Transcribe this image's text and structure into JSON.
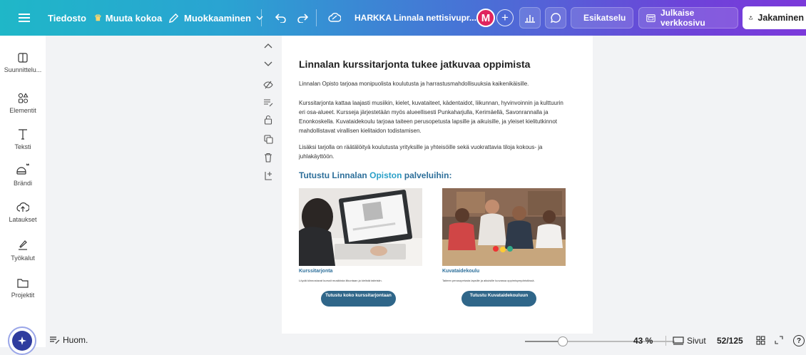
{
  "toolbar": {
    "file_label": "Tiedosto",
    "resize_label": "Muuta kokoa",
    "edit_label": "Muokkaaminen",
    "doc_title": "HARKKA Linnala nettisivupr...",
    "avatar_initial": "M",
    "preview_label": "Esikatselu",
    "publish_label": "Julkaise verkkosivu",
    "share_label": "Jakaminen"
  },
  "sidebar": {
    "items": [
      {
        "label": "Suunnittelu...",
        "icon": "design-icon"
      },
      {
        "label": "Elementit",
        "icon": "elements-icon"
      },
      {
        "label": "Teksti",
        "icon": "text-icon"
      },
      {
        "label": "Brändi",
        "icon": "brand-icon"
      },
      {
        "label": "Lataukset",
        "icon": "uploads-icon"
      },
      {
        "label": "Työkalut",
        "icon": "tools-icon"
      },
      {
        "label": "Projektit",
        "icon": "projects-icon"
      }
    ]
  },
  "page": {
    "heading": "Linnalan kurssitarjonta tukee jatkuvaa oppimista",
    "para1": "Linnalan Opisto tarjoaa monipuolista koulutusta ja harrastusmahdollisuuksia kaikenikäisille.",
    "para2": "Kurssitarjonta kattaa laajasti musiikin, kielet, kuvataiteet, kädentaidot, liikunnan, hyvinvoinnin ja kulttuurin eri osa-alueet. Kursseja järjestetään myös alueellisesti Punkaharjulla, Kerimäellä, Savonrannalla ja Enonkoskella. Kuvataidekoulu tarjoaa taiteen perusopetusta lapsille ja aikuisille, ja yleiset kielitutkinnot mahdollistavat virallisen kielitaidon todistamisen.",
    "para3": "Lisäksi tarjolla on räätälöityä koulutusta yrityksille ja yhteisöille sekä vuokrattavia tiloja kokous- ja juhlakäyttöön.",
    "subheading_pre": "Tutustu Linnalan ",
    "subheading_accent": "Opiston",
    "subheading_post": " palveluihin:",
    "cards": [
      {
        "title": "Kurssitarjonta",
        "desc": "Löydä kiinnostavat kurssit musiikista liikuntaan ja kielistä taiteisiin.",
        "button": "Tutustu koko kurssitarjontaan"
      },
      {
        "title": "Kuvataidekoulu",
        "desc": "Taiteen perusopetusta lapsille ja aikuisille luovassa oppimisympäristössä.",
        "button": "Tutustu Kuvataidekouluun"
      }
    ]
  },
  "statusbar": {
    "notes_label": "Huom.",
    "zoom_percent": 43,
    "zoom_label": "43 %",
    "pages_label": "Sivut",
    "page_count": "52/125"
  },
  "colors": {
    "accent_heading": "#2d6f9a",
    "button_bg": "#2f6689",
    "avatar": "#e0245e"
  }
}
